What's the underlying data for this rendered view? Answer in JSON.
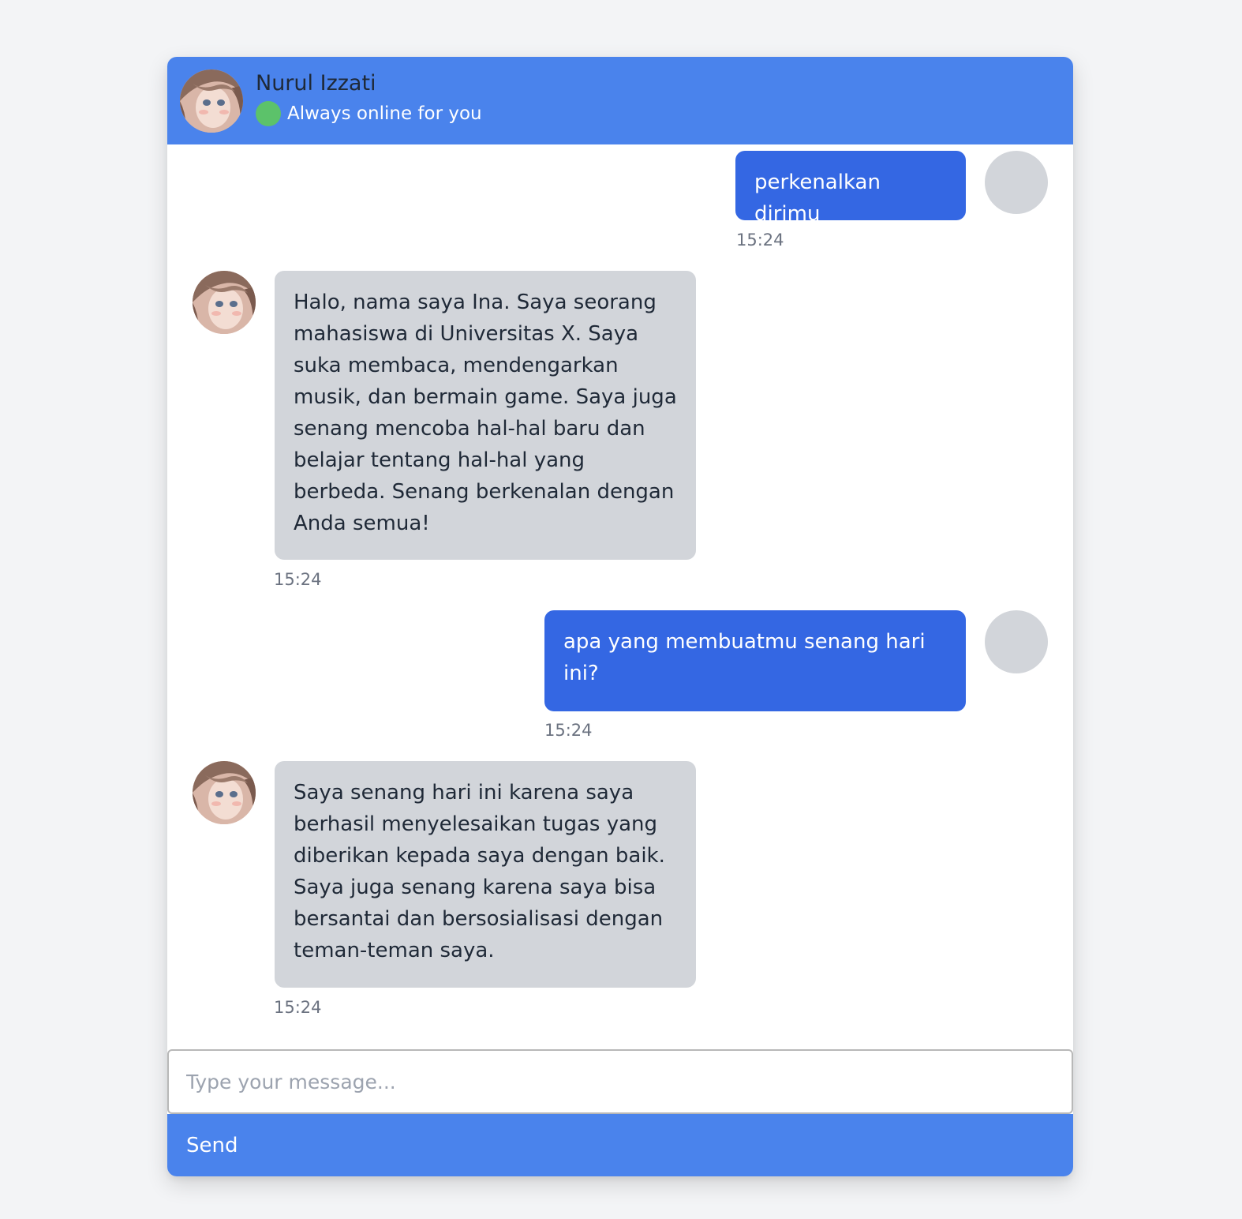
{
  "header": {
    "name": "Nurul Izzati",
    "status": "Always online for you",
    "status_color": "#5cc26a",
    "background_color": "#4a83ec"
  },
  "messages": [
    {
      "sender": "user",
      "text": "perkenalkan dirimu",
      "time": "15:24"
    },
    {
      "sender": "bot",
      "text": "Halo, nama saya Ina. Saya seorang mahasiswa di Universitas X. Saya suka membaca, mendengarkan musik, dan bermain game. Saya juga senang mencoba hal-hal baru dan belajar tentang hal-hal yang berbeda. Senang berkenalan dengan Anda semua!",
      "time": "15:24"
    },
    {
      "sender": "user",
      "text": "apa yang membuatmu senang hari ini?",
      "time": "15:24"
    },
    {
      "sender": "bot",
      "text": "Saya senang hari ini karena saya berhasil menyelesaikan tugas yang diberikan kepada saya dengan baik. Saya juga senang karena saya bisa bersantai dan bersosialisasi dengan teman-teman saya.",
      "time": "15:24"
    }
  ],
  "composer": {
    "placeholder": "Type your message...",
    "value": "",
    "send_label": "Send"
  },
  "colors": {
    "user_bubble": "#3467e3",
    "bot_bubble": "#d2d5da",
    "page_background": "#f3f4f6"
  }
}
